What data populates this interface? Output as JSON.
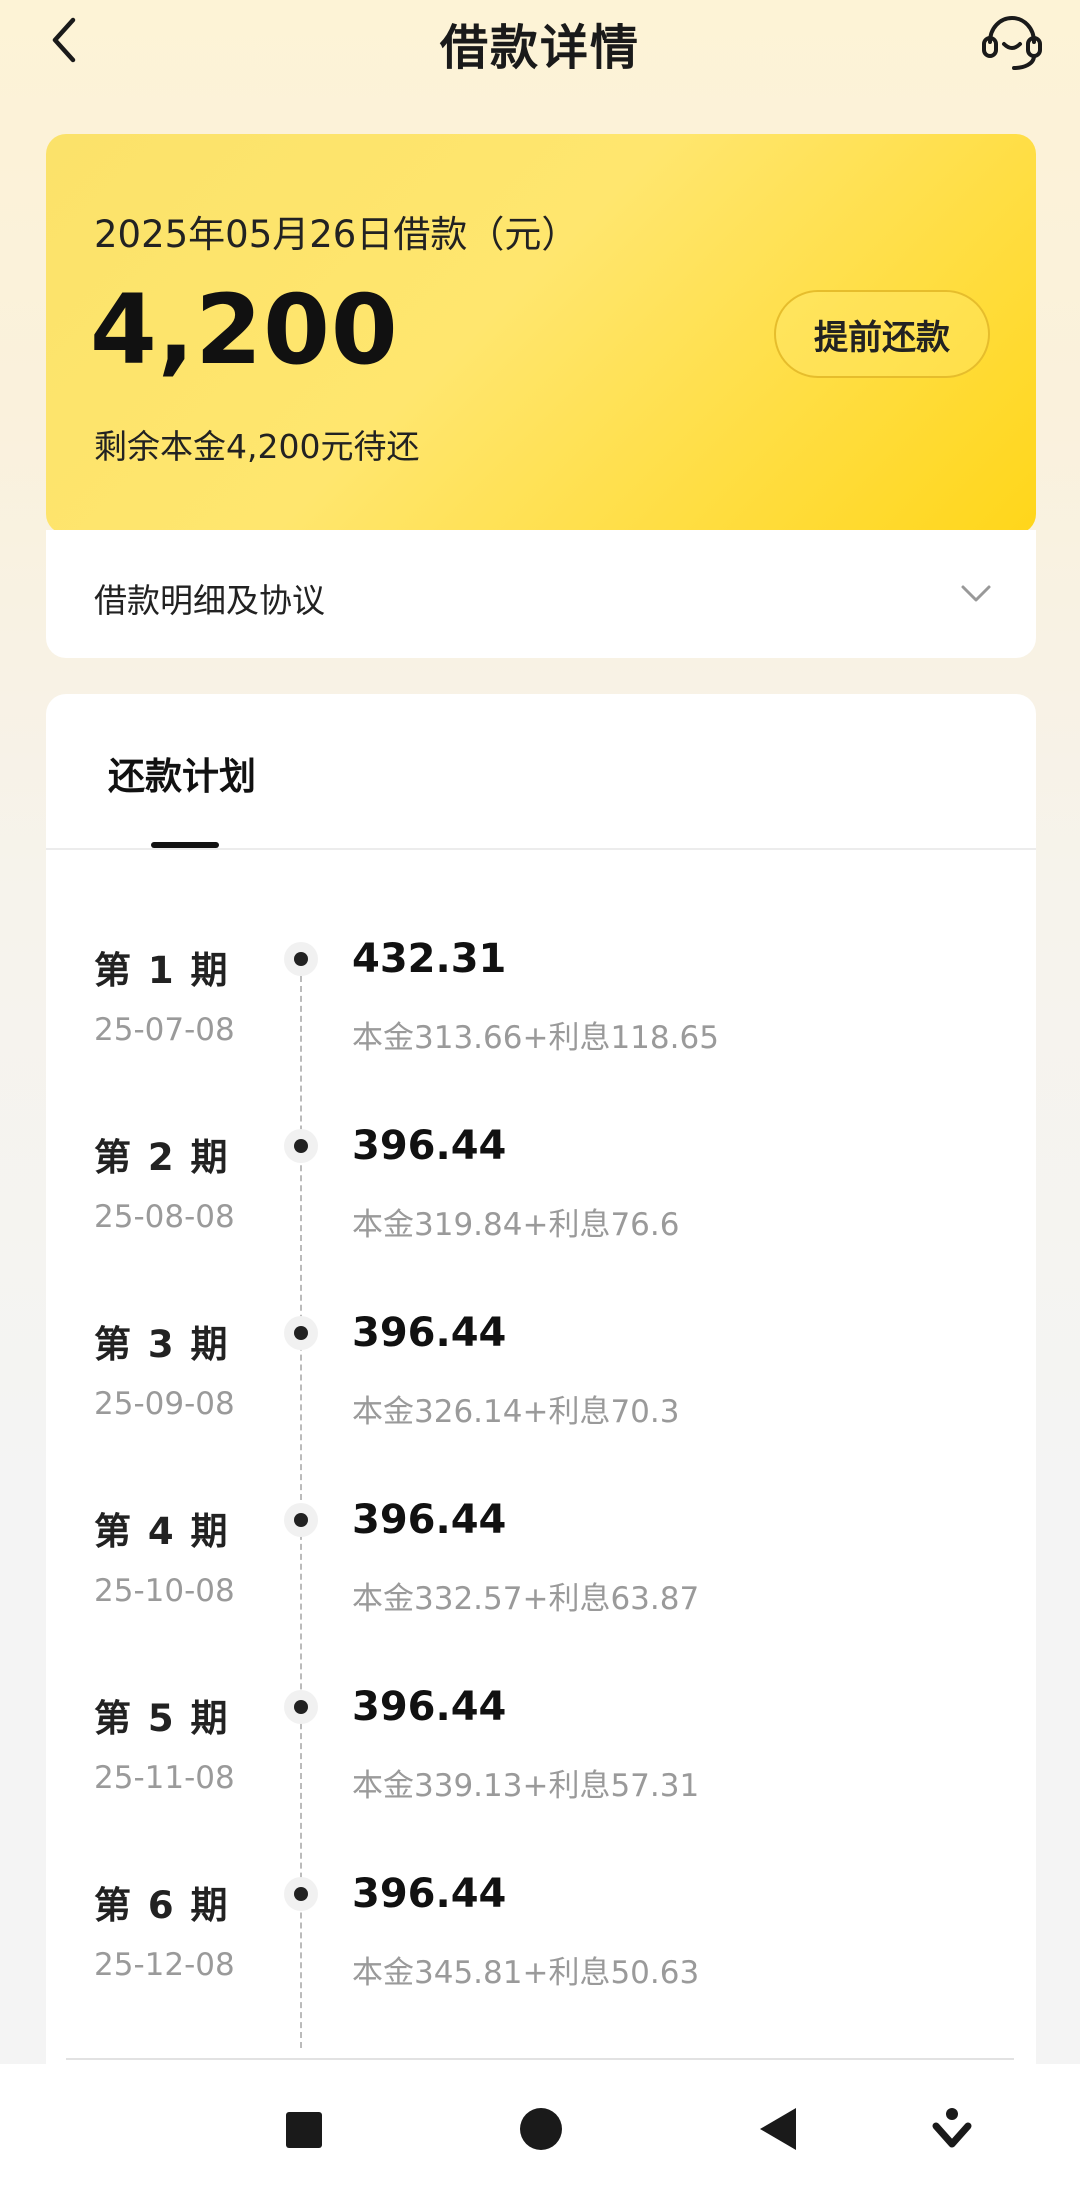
{
  "header": {
    "title": "借款详情",
    "back_icon": "chevron-left-icon",
    "service_icon": "headset-icon"
  },
  "loan": {
    "date_label": "2025年05月26日借款（元）",
    "amount": "4,200",
    "prepay_button": "提前还款",
    "remaining": "剩余本金4,200元待还"
  },
  "agreement": {
    "label": "借款明细及协议",
    "icon": "chevron-down-icon"
  },
  "plan": {
    "tab_label": "还款计划",
    "periods": [
      {
        "label": "第 1 期",
        "date": "25-07-08",
        "amount": "432.31",
        "detail": "本金313.66+利息118.65"
      },
      {
        "label": "第 2 期",
        "date": "25-08-08",
        "amount": "396.44",
        "detail": "本金319.84+利息76.6"
      },
      {
        "label": "第 3 期",
        "date": "25-09-08",
        "amount": "396.44",
        "detail": "本金326.14+利息70.3"
      },
      {
        "label": "第 4 期",
        "date": "25-10-08",
        "amount": "396.44",
        "detail": "本金332.57+利息63.87"
      },
      {
        "label": "第 5 期",
        "date": "25-11-08",
        "amount": "396.44",
        "detail": "本金339.13+利息57.31"
      },
      {
        "label": "第 6 期",
        "date": "25-12-08",
        "amount": "396.44",
        "detail": "本金345.81+利息50.63"
      }
    ]
  },
  "colors": {
    "card_yellow": "#ffe066",
    "accent_border": "#e6bd2c",
    "muted_text": "#9a9a9a"
  }
}
